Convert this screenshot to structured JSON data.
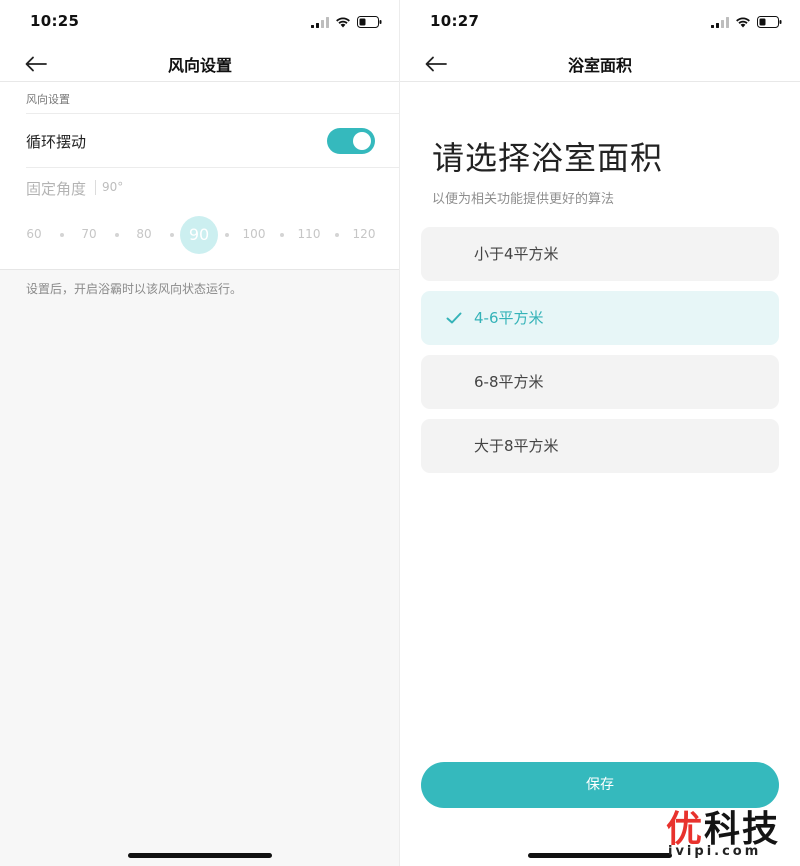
{
  "left": {
    "status": {
      "time": "10:25"
    },
    "nav": {
      "title": "风向设置"
    },
    "section_label": "风向设置",
    "swing": {
      "label": "循环摆动",
      "enabled": true
    },
    "fixed_angle": {
      "label": "固定角度",
      "value": "90°"
    },
    "angles": [
      "60",
      "70",
      "80",
      "90",
      "100",
      "110",
      "120"
    ],
    "selected_angle": "90",
    "hint": "设置后，开启浴霸时以该风向状态运行。"
  },
  "right": {
    "status": {
      "time": "10:27"
    },
    "nav": {
      "title": "浴室面积"
    },
    "heading": "请选择浴室面积",
    "subheading": "以便为相关功能提供更好的算法",
    "options": [
      {
        "label": "小于4平方米",
        "selected": false
      },
      {
        "label": "4-6平方米",
        "selected": true
      },
      {
        "label": "6-8平方米",
        "selected": false
      },
      {
        "label": "大于8平方米",
        "selected": false
      }
    ],
    "save_label": "保存"
  },
  "watermark": {
    "brand_red": "优",
    "brand_black": "科技",
    "url": "ivipi.com"
  },
  "colors": {
    "accent": "#35b9bd",
    "selected_bg": "#e7f6f7",
    "selected_text": "#35b3b8",
    "watermark_red": "#e8322d"
  }
}
